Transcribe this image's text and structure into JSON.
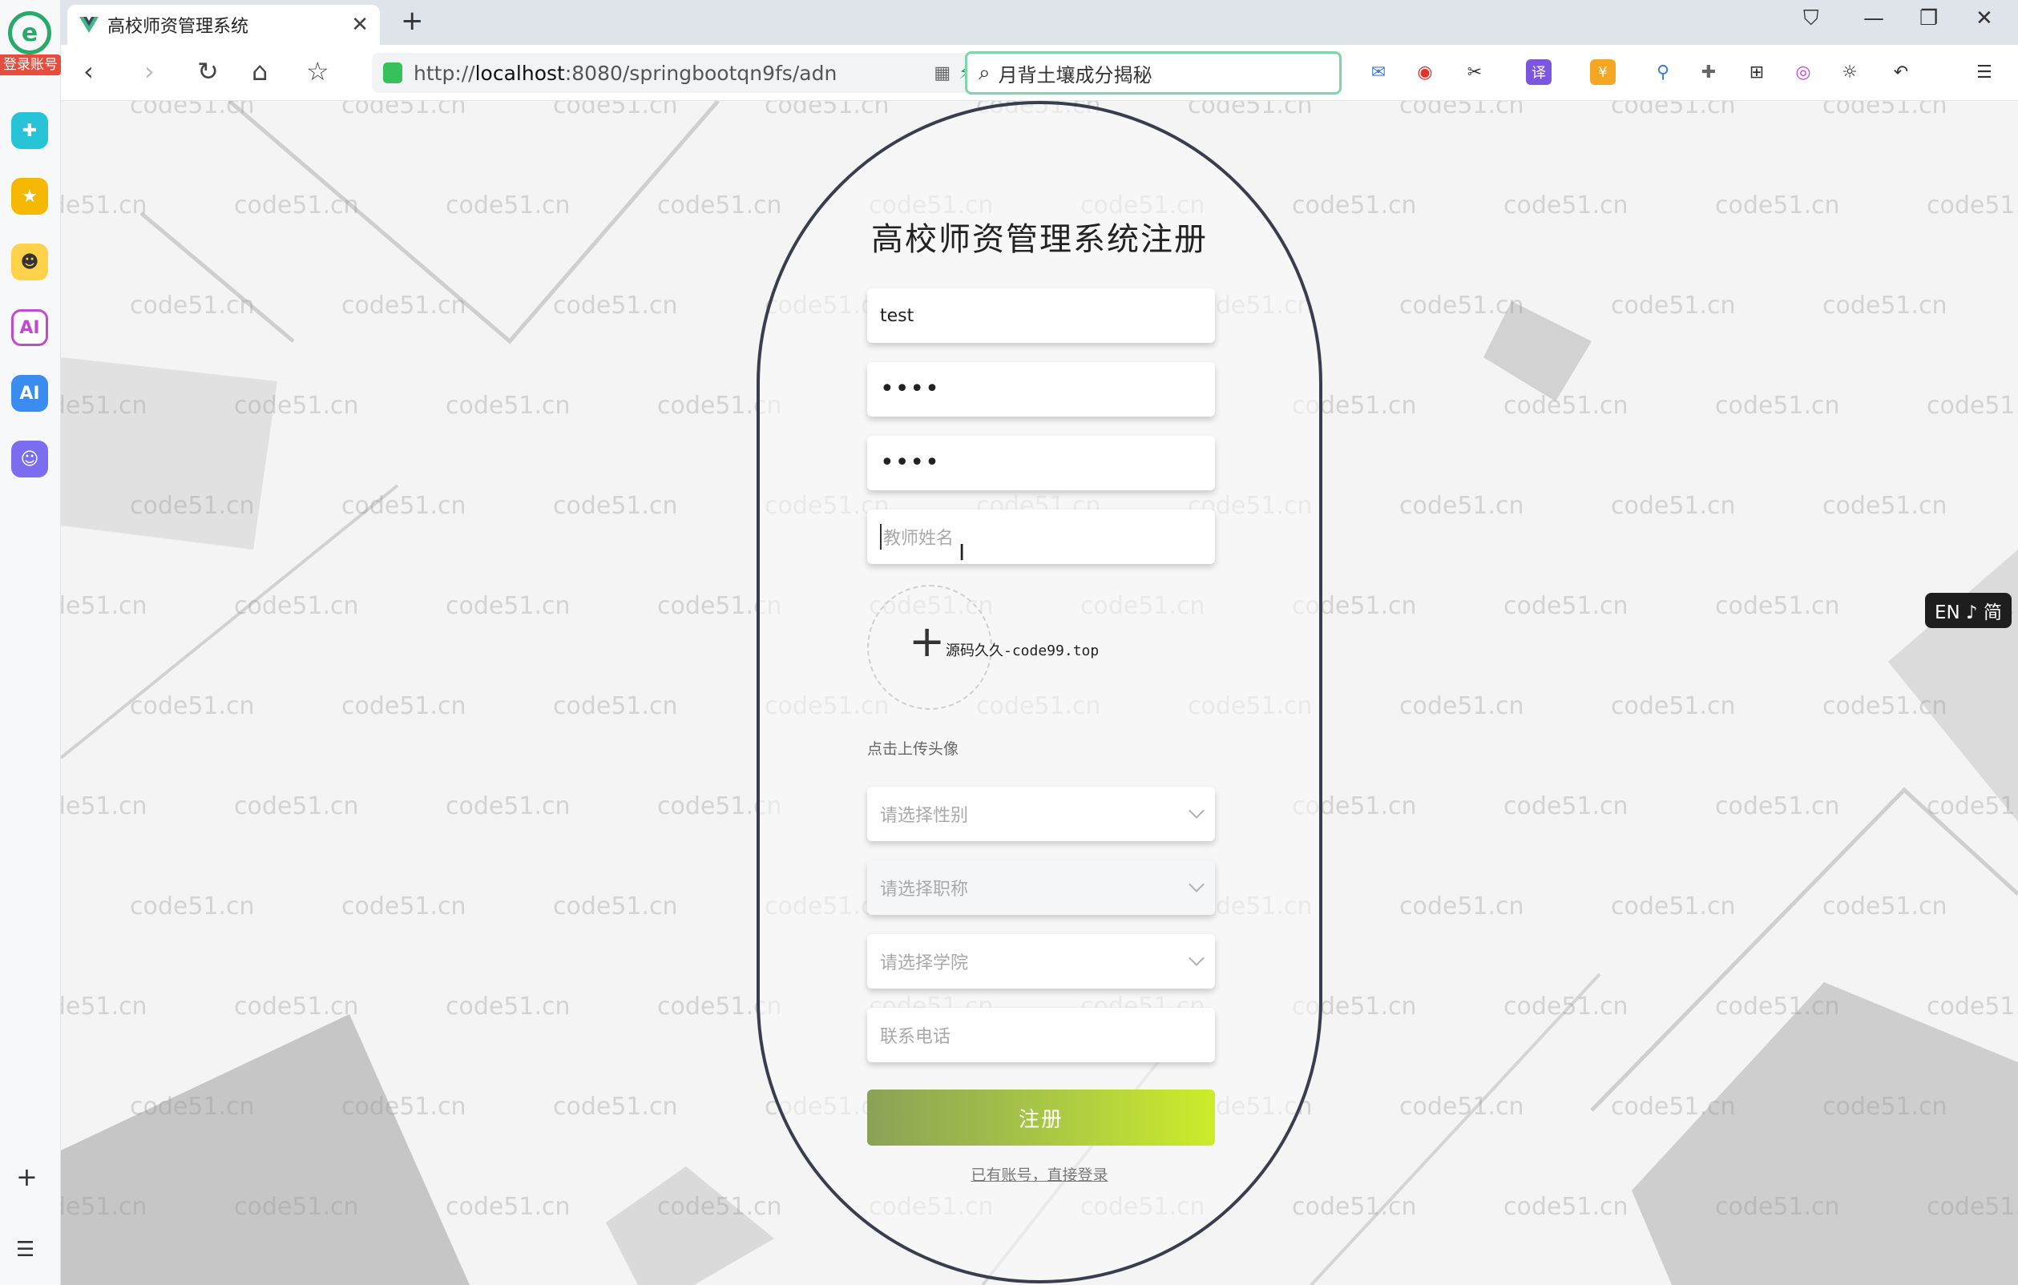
{
  "browser": {
    "tab_title": "高校师资管理系统",
    "url_prefix": "http://",
    "url_host": "localhost",
    "url_rest": ":8080/springbootqn9fs/adn",
    "search_text": "月背土壤成分揭秘"
  },
  "sidebar": {
    "badge": "登录账号"
  },
  "page": {
    "watermark": "code51.cn",
    "lang_switch": "EN ♪ 简"
  },
  "form": {
    "title": "高校师资管理系统注册",
    "username_value": "test",
    "password_mask": "••••",
    "confirm_password_mask": "••••",
    "teacher_name_placeholder": "教师姓名",
    "avatar_plus": "+",
    "avatar_watermark": "源码久久-code99.top",
    "upload_hint": "点击上传头像",
    "gender_placeholder": "请选择性别",
    "title_rank_placeholder": "请选择职称",
    "college_placeholder": "请选择学院",
    "phone_placeholder": "联系电话",
    "register_label": "注册",
    "login_link": "已有账号，直接登录"
  },
  "colors": {
    "accent_green": "#36c25a",
    "card_border": "#3a3d4e",
    "button_start": "#8aa257",
    "button_end": "#ccec2a"
  },
  "icons": [
    "vue-icon",
    "back-icon",
    "forward-icon",
    "refresh-icon",
    "home-icon",
    "star-icon",
    "search-icon",
    "close-icon",
    "plus-icon",
    "menu-icon"
  ]
}
